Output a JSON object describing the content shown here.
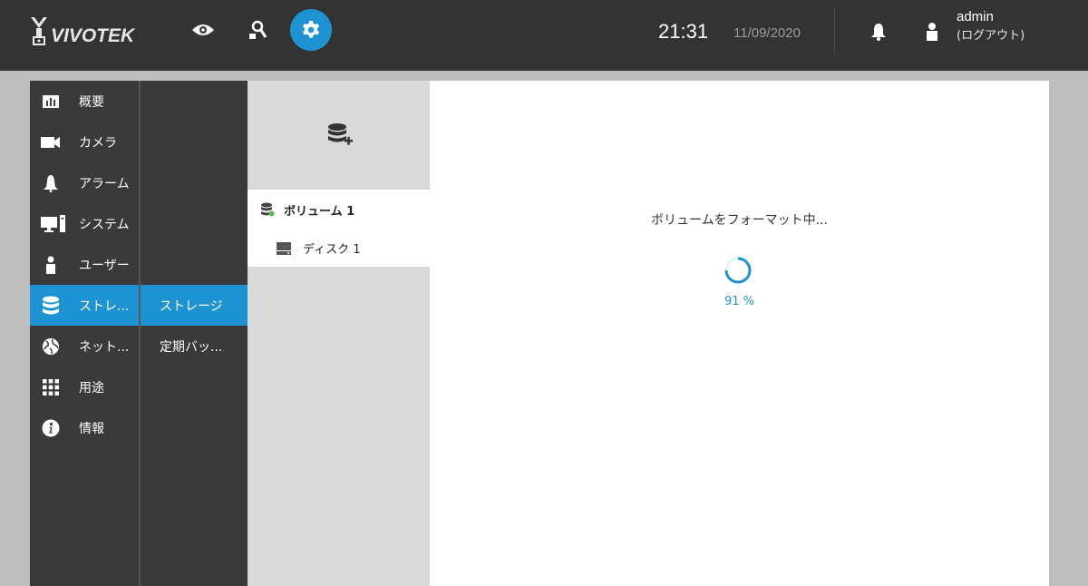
{
  "header": {
    "logo_text": "VIVOTEK",
    "time": "21:31",
    "date": "11/09/2020",
    "username": "admin",
    "logout_label": "(ログアウト)",
    "accent_color": "#1e93d3",
    "nav": [
      {
        "name": "live-view",
        "icon": "eye-icon"
      },
      {
        "name": "search",
        "icon": "person-search-icon"
      },
      {
        "name": "settings",
        "icon": "gear-icon",
        "active": true
      }
    ]
  },
  "sidebar": {
    "items": [
      {
        "label": "概要",
        "icon": "chart-icon"
      },
      {
        "label": "カメラ",
        "icon": "camera-icon"
      },
      {
        "label": "アラーム",
        "icon": "bell-icon"
      },
      {
        "label": "システム",
        "icon": "monitor-icon"
      },
      {
        "label": "ユーザー",
        "icon": "user-icon"
      },
      {
        "label": "ストレ...",
        "icon": "database-icon",
        "active": true
      },
      {
        "label": "ネット...",
        "icon": "globe-icon"
      },
      {
        "label": "用途",
        "icon": "grid-icon"
      },
      {
        "label": "情報",
        "icon": "info-icon"
      }
    ]
  },
  "submenu": {
    "items": [
      {
        "label": "ストレージ",
        "active": true
      },
      {
        "label": "定期バッ..."
      }
    ]
  },
  "tree": {
    "add_icon": "add-database-icon",
    "volume_label": "ボリューム 1",
    "disk_label": "ディスク 1"
  },
  "main": {
    "status_text": "ボリュームをフォーマット中...",
    "progress_percent": 91,
    "progress_label": "91 %"
  }
}
